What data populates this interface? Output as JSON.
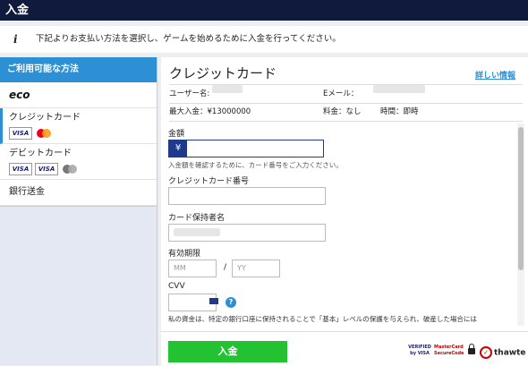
{
  "window": {
    "title": "入金"
  },
  "info": {
    "icon": "info-icon",
    "text": "下記よりお支払い方法を選択し、ゲームを始めるために入金を行ってください。"
  },
  "sidebar": {
    "header": "ご利用可能な方法",
    "items": [
      {
        "label": "eco",
        "logos": []
      },
      {
        "label": "クレジットカード",
        "logos": [
          "VISA",
          "mastercard"
        ],
        "active": true
      },
      {
        "label": "デビットカード",
        "logos": [
          "VISA",
          "VISA",
          "mastercard"
        ]
      },
      {
        "label": "銀行送金",
        "logos": []
      }
    ]
  },
  "panel": {
    "title": "クレジットカード",
    "details_link": "詳しい情報",
    "user_label": "ユーザー名:",
    "email_label": "Eメール：",
    "max_deposit": "最大入金：¥13000000",
    "fee": "料金：なし",
    "time": "時間：即時"
  },
  "form": {
    "amount_label": "金額",
    "currency_symbol": "¥",
    "amount_hint": "入金額を確認するために、カード番号をご入力ください。",
    "card_number_label": "クレジットカード番号",
    "holder_label": "カード保持者名",
    "expiry_label": "有効期限",
    "mm_placeholder": "MM",
    "yy_placeholder": "YY",
    "expiry_separator": "/",
    "cvv_label": "CVV",
    "help_icon": "?",
    "notice": "私の資金は、特定の銀行口座に保持されることで「基本」レベルの保護を与えられ、破産した場合には"
  },
  "footer": {
    "pay_button": "入金",
    "badge_visa": "VERIFIED by VISA",
    "badge_mc": "MasterCard SecureCode",
    "thawte": "thawte"
  },
  "colors": {
    "topbar": "#0f1a3d",
    "accent": "#2d8fd4",
    "pay_button": "#22c232",
    "field_border": "#1f3a8a"
  }
}
